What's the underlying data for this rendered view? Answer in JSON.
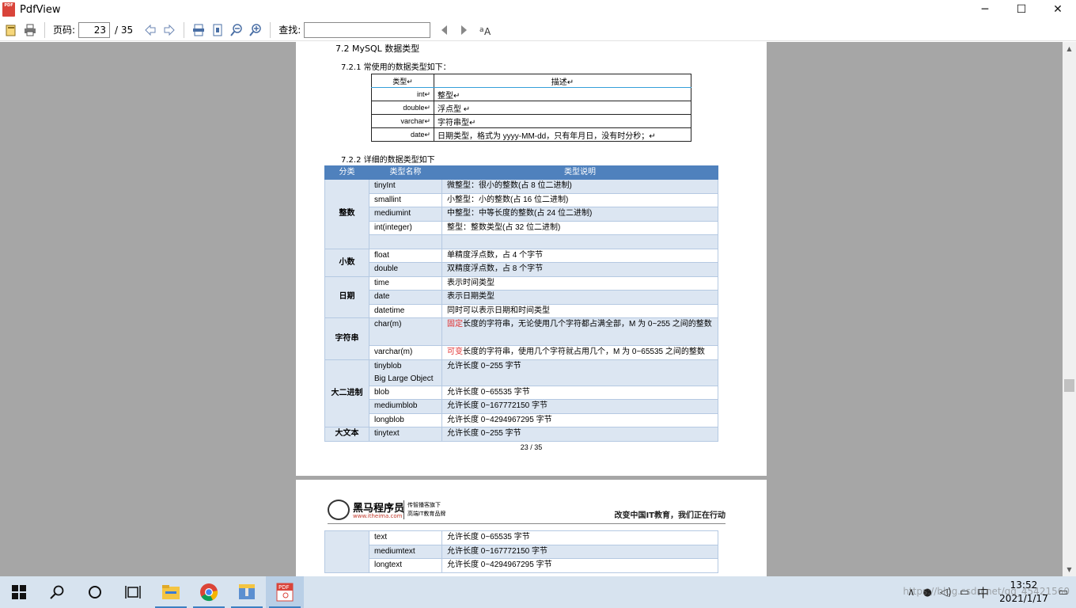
{
  "window": {
    "title": "PdfView",
    "minimize": "─",
    "maximize": "☐",
    "close": "✕"
  },
  "toolbar": {
    "page_label": "页码:",
    "page_value": "23",
    "page_total": "/ 35",
    "find_label": "查找:",
    "find_value": ""
  },
  "page1": {
    "h2": "7.2    MySQL 数据类型",
    "h3a": "7.2.1      常使用的数据类型如下：",
    "table1": {
      "headers": [
        "类型↵",
        "描述↵"
      ],
      "rows": [
        [
          "int↵",
          "整型↵"
        ],
        [
          "double↵",
          "浮点型  ↵"
        ],
        [
          "varchar↵",
          "字符串型↵"
        ],
        [
          "date↵",
          "日期类型，格式为 yyyy-MM-dd，只有年月日，没有时分秒；↵"
        ]
      ]
    },
    "h3b": "7.2.2      详细的数据类型如下",
    "table2": {
      "headers": [
        "分类",
        "类型名称",
        "类型说明"
      ],
      "groups": {
        "int": "整数",
        "dec": "小数",
        "date": "日期",
        "str": "字符串",
        "bin": "大二进制",
        "txt": "大文本"
      },
      "rows": {
        "tinyint": [
          "tinyInt",
          "微整型：很小的整数(占 8 位二进制)"
        ],
        "smallint": [
          "smallint",
          "小整型：小的整数(占 16 位二进制)"
        ],
        "mediumint": [
          "mediumint",
          "中整型：中等长度的整数(占 24 位二进制)"
        ],
        "integer": [
          "int(integer)",
          "整型：整数类型(占 32 位二进制)"
        ],
        "float": [
          "float",
          "单精度浮点数，占 4 个字节"
        ],
        "double": [
          "double",
          "双精度浮点数，占 8 个字节"
        ],
        "time": [
          "time",
          "表示时间类型"
        ],
        "date": [
          "date",
          "表示日期类型"
        ],
        "datetime": [
          "datetime",
          "同时可以表示日期和时间类型"
        ],
        "char": [
          "char(m)",
          "固定",
          "长度的字符串，无论使用几个字符都占满全部，M 为 0~255 之间的整数"
        ],
        "varchar": [
          "varchar(m)",
          "可变",
          "长度的字符串，使用几个字符就占用几个，M 为 0~65535 之间的整数"
        ],
        "tinyblob": [
          "tinyblob",
          "Big Large Object",
          "允许长度 0~255 字节"
        ],
        "blob": [
          "blob",
          "允许长度 0~65535 字节"
        ],
        "mediumblob": [
          "mediumblob",
          "允许长度 0~167772150 字节"
        ],
        "longblob": [
          "longblob",
          "允许长度 0~4294967295 字节"
        ],
        "tinytext": [
          "tinytext",
          "允许长度 0~255 字节"
        ]
      }
    },
    "page_number": "23 / 35"
  },
  "page2": {
    "logo_name": "黑马程序员",
    "logo_url": "www.itheima.com",
    "logo_sub1": "传智播客旗下",
    "logo_sub2": "高端IT教育品牌",
    "slogan": "改变中国IT教育，我们正在行动",
    "rows": [
      [
        "text",
        "允许长度 0~65535 字节"
      ],
      [
        "mediumtext",
        "允许长度 0~167772150 字节"
      ],
      [
        "longtext",
        "允许长度 0~4294967295 字节"
      ]
    ]
  },
  "taskbar": {
    "time": "13:52",
    "date": "2021/1/17",
    "ime": "中",
    "watermark": "https://blog.csdn.net/qq_45421560"
  },
  "colors": {
    "header_blue": "#4f81bd",
    "band": "#dce6f2",
    "taskbar": "#d7e3ef",
    "viewer_bg": "#a6a6a6"
  }
}
